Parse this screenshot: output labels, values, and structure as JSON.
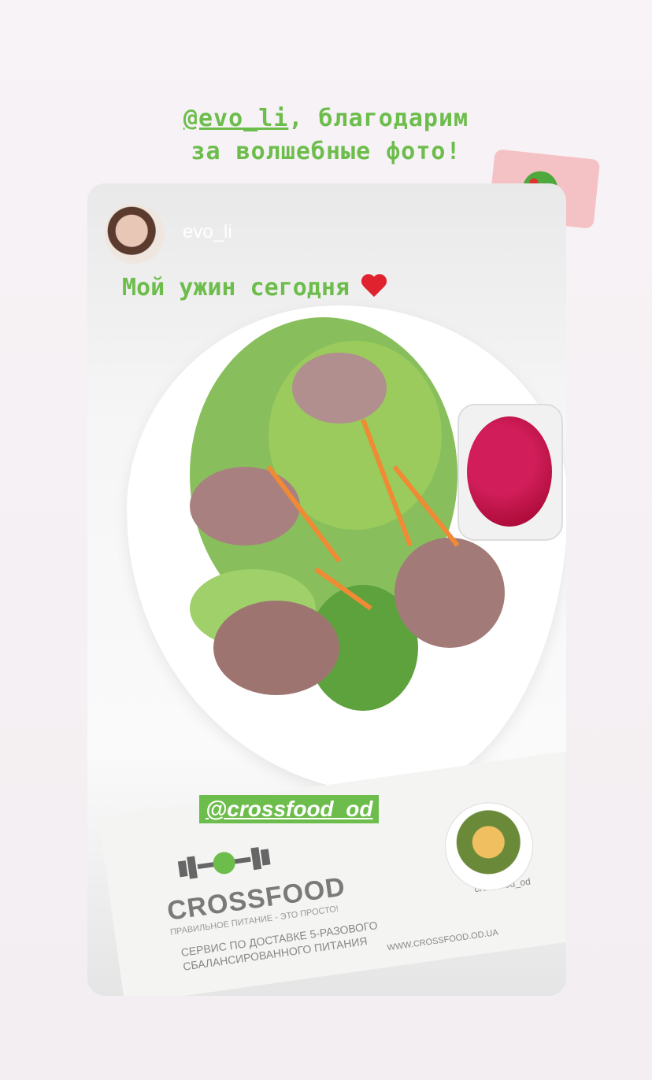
{
  "caption": {
    "mention": "@evo_li",
    "line1_rest": ", благодарим",
    "line2": "за волшебные фото!"
  },
  "story": {
    "username": "evo_li",
    "headline": "Мой ужин сегодня"
  },
  "tag": "@crossfood_od",
  "flyer": {
    "brand": "CROSSFOOD",
    "tagline": "ПРАВИЛЬНОЕ ПИТАНИЕ - ЭТО ПРОСТО!",
    "service": "СЕРВИС ПО ДОСТАВКЕ 5-РАЗОВОГО СБАЛАНСИРОВАННОГО ПИТАНИЯ",
    "website": "WWW.CROSSFOOD.OD.UA",
    "handle": "crossfood_od"
  },
  "colors": {
    "accent_green": "#6dbd4c",
    "heart_red": "#e0212e"
  }
}
